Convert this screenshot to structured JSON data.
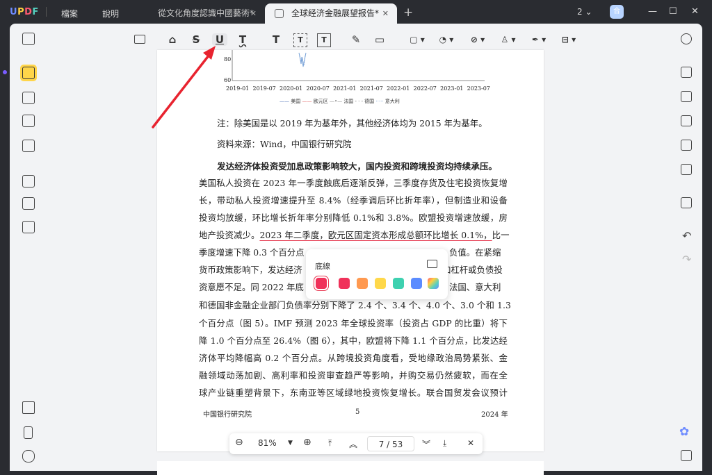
{
  "app": {
    "logo": "UPDF",
    "menu": [
      "檔案",
      "說明"
    ],
    "tabs": [
      {
        "label": "從文化角度認識中國藝術*",
        "active": false
      },
      {
        "label": "全球经济金融展望报告*",
        "active": true
      }
    ],
    "page_count_indicator": "2",
    "avatar_initial": "合"
  },
  "toolbar": {
    "tools": [
      "comment-icon",
      "highlight-icon",
      "strikethrough-icon",
      "underline-icon",
      "squiggly-icon",
      "text-icon",
      "textbox-icon",
      "text-callout-icon",
      "pencil-icon",
      "eraser-icon",
      "shape-icon",
      "stamp-circle-icon",
      "attachment-icon",
      "stamp-icon",
      "signature-icon",
      "measure-icon"
    ],
    "active_tool": "underline-icon"
  },
  "document": {
    "chart_fragment": {
      "ytick": "60",
      "y80": "80",
      "xticks": [
        "2019-01",
        "2019-07",
        "2020-01",
        "2020-07",
        "2021-01",
        "2021-07",
        "2022-01",
        "2022-07",
        "2023-01",
        "2023-07"
      ],
      "legend": [
        "美国",
        "欧元区",
        "法国",
        "德国",
        "意大利"
      ]
    },
    "note1": "注：除美国是以 2019 年为基年外，其他经济体均为 2015 年为基年。",
    "note2": "资料来源：Wind，中国银行研究院",
    "heading": "发达经济体投资受加息政策影响较大，国内投资和跨境投资均持续承压。",
    "lines": [
      "美国私人投资在 2023 年一季度触底后逐渐反弹，三季度存货及住宅投资恢复增",
      "长，带动私人投资增速提升至 8.4%（经季调后环比折年率），但制造业和设备",
      "投资均放缓，环比增长折年率分别降低 0.1%和 3.8%。欧盟投资增速放缓，房"
    ],
    "line4_pre": "地产投资减少。",
    "line4_ul": "2023 年二季度，欧元区固定资本形成总额环比增长 0.1%，",
    "line4_post": "比一",
    "line5_a": "季度增速下降 0.3 个百分点",
    "line5_b": "负值。在紧缩",
    "line6_a": "货币政策影响下，发达经济",
    "line6_b": "加杠杆或负债投",
    "line7_a": "资意愿不足。同 2022 年底",
    "line7_b": "法国、意大利",
    "lines_after": [
      "和德国非金融企业部门负债率分别下降了 2.4 个、3.4 个、4.0 个、3.0 个和 1.3",
      "个百分点（图 5）。IMF 预测 2023 年全球投资率（投资占 GDP 的比重）将下",
      "降 1.0 个百分点至 26.4%（图 6），其中，欧盟将下降 1.1 个百分点，比发达经",
      "济体平均降幅高 0.2 个百分点。从跨境投资角度看，受地缘政治局势紧张、金",
      "融领域动荡加剧、高利率和投资审查趋严等影响，并购交易仍然疲软，而在全",
      "球产业链重塑背景下，东南亚等区域绿地投资恢复增长。联合国贸发会议预计"
    ],
    "footer_left": "中国银行研究院",
    "footer_center": "5",
    "footer_right": "2024 年"
  },
  "underline_popup": {
    "label": "底線",
    "colors": [
      "#f0315a",
      "#f0315a",
      "#ff9950",
      "#ffd84a",
      "#3ed1b0",
      "#5b8cff",
      "rainbow"
    ],
    "selected": 0
  },
  "page_nav": {
    "zoom": "81%",
    "current_page": "7",
    "total_pages": "53",
    "page_display": "7 / 53"
  }
}
